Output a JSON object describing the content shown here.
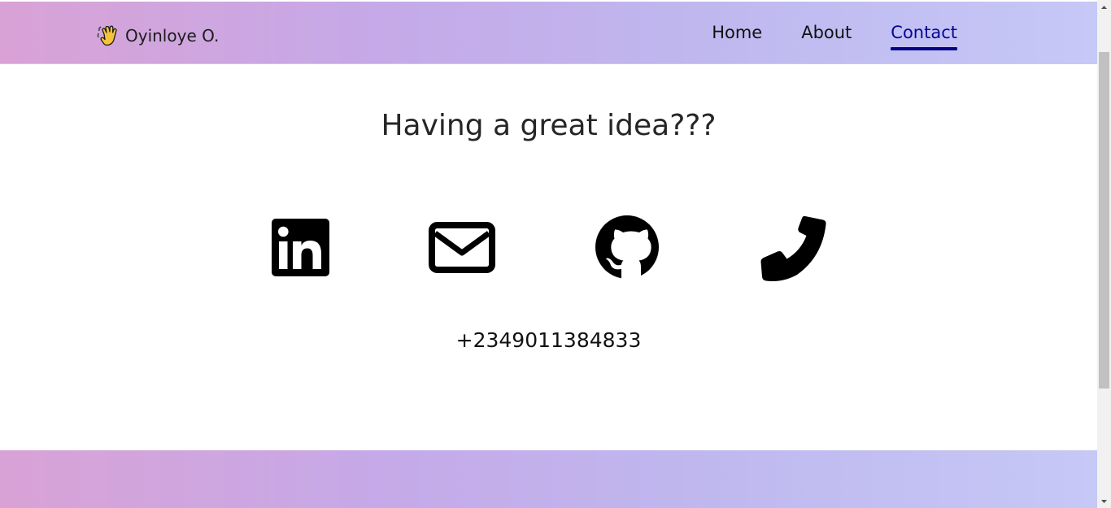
{
  "brand": {
    "icon": "waving-hand-icon",
    "name": "Oyinloye O."
  },
  "nav": {
    "items": [
      {
        "label": "Home",
        "active": false
      },
      {
        "label": "About",
        "active": false
      },
      {
        "label": "Contact",
        "active": true
      }
    ],
    "active_color": "#060694"
  },
  "main": {
    "heading": "Having a great idea???",
    "contact_icons": [
      {
        "icon": "linkedin-icon"
      },
      {
        "icon": "email-icon"
      },
      {
        "icon": "github-icon"
      },
      {
        "icon": "phone-icon"
      }
    ],
    "phone": "+2349011384833"
  },
  "theme": {
    "gradient_start": "#d9a2d6",
    "gradient_end": "#c6c8f6"
  }
}
